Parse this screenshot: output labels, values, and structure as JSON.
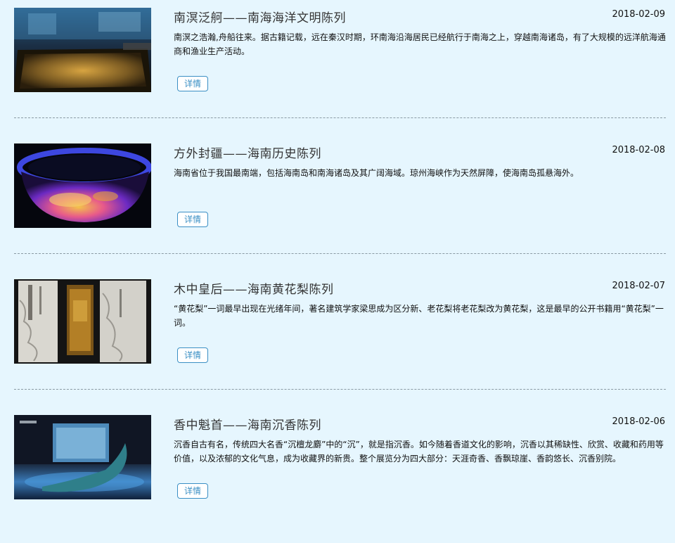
{
  "exhibitions": [
    {
      "title": "南溟泛舸——南海海洋文明陈列",
      "date": "2018-02-09",
      "description": "南溟之浩瀚,舟船往来。据古籍记载，远在秦汉时期，环南海沿海居民已经航行于南海之上，穿越南海诸岛，有了大规模的远洋航海通商和渔业生产活动。",
      "detail_label": "详情"
    },
    {
      "title": "方外封疆——海南历史陈列",
      "date": "2018-02-08",
      "description": "海南省位于我国最南端，包括海南岛和南海诸岛及其广阔海域。琼州海峡作为天然屏障，使海南岛孤悬海外。",
      "detail_label": "详情"
    },
    {
      "title": "木中皇后——海南黄花梨陈列",
      "date": "2018-02-07",
      "description": "“黄花梨”一词最早出现在光绪年间，著名建筑学家梁思成为区分新、老花梨将老花梨改为黄花梨，这是最早的公开书籍用“黄花梨”一词。",
      "detail_label": "详情"
    },
    {
      "title": "香中魁首——海南沉香陈列",
      "date": "2018-02-06",
      "description": "沉香自古有名，传统四大名香“沉檀龙麝”中的“沉”，就是指沉香。如今随着香道文化的影响，沉香以其稀缺性、欣赏、收藏和药用等价值，以及浓郁的文化气息，成为收藏界的新贵。整个展览分为四大部分：天涯奇香、香飘琼崖、香韵悠长、沉香别院。",
      "detail_label": "详情"
    }
  ]
}
